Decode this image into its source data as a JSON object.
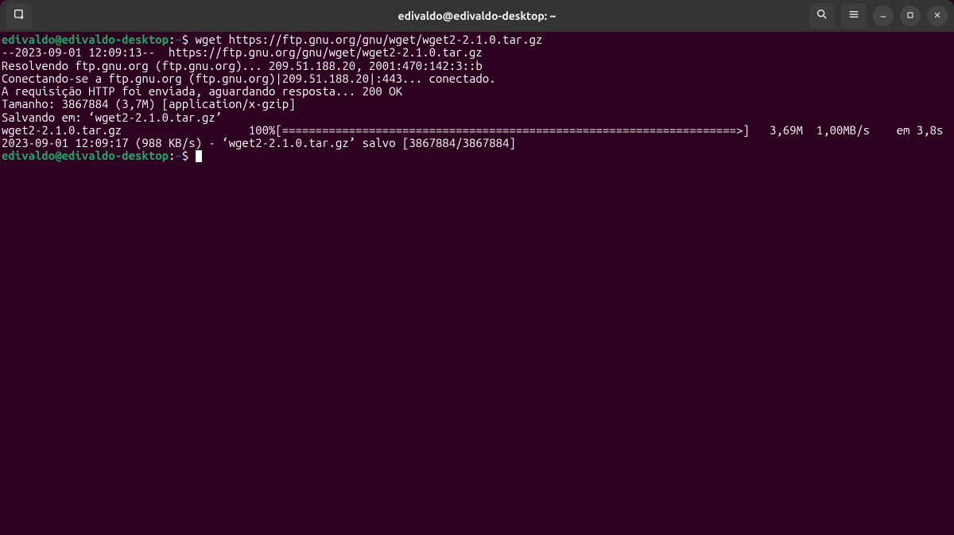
{
  "header": {
    "title": "edivaldo@edivaldo-desktop: ~",
    "icons": {
      "new_tab": "new-tab-icon",
      "search": "search-icon",
      "menu": "hamburger-icon",
      "minimize": "minimize-icon",
      "maximize": "maximize-icon",
      "close": "close-icon"
    }
  },
  "prompt": {
    "user_host": "edivaldo@edivaldo-desktop",
    "sep": ":",
    "path": "~",
    "symbol": "$"
  },
  "terminal": {
    "lines": [
      {
        "type": "prompt",
        "command": "wget https://ftp.gnu.org/gnu/wget/wget2-2.1.0.tar.gz"
      },
      {
        "type": "out",
        "text": "--2023-09-01 12:09:13--  https://ftp.gnu.org/gnu/wget/wget2-2.1.0.tar.gz"
      },
      {
        "type": "out",
        "text": "Resolvendo ftp.gnu.org (ftp.gnu.org)... 209.51.188.20, 2001:470:142:3::b"
      },
      {
        "type": "out",
        "text": "Conectando-se a ftp.gnu.org (ftp.gnu.org)|209.51.188.20|:443... conectado."
      },
      {
        "type": "out",
        "text": "A requisição HTTP foi enviada, aguardando resposta... 200 OK"
      },
      {
        "type": "out",
        "text": "Tamanho: 3867884 (3,7M) [application/x-gzip]"
      },
      {
        "type": "out",
        "text": "Salvando em: ‘wget2-2.1.0.tar.gz’"
      },
      {
        "type": "out",
        "text": ""
      },
      {
        "type": "out",
        "text": "wget2-2.1.0.tar.gz                   100%[====================================================================>]   3,69M  1,00MB/s    em 3,8s    "
      },
      {
        "type": "out",
        "text": ""
      },
      {
        "type": "out",
        "text": "2023-09-01 12:09:17 (988 KB/s) - ‘wget2-2.1.0.tar.gz’ salvo [3867884/3867884]"
      },
      {
        "type": "out",
        "text": ""
      },
      {
        "type": "prompt",
        "command": "",
        "cursor": true
      }
    ]
  }
}
